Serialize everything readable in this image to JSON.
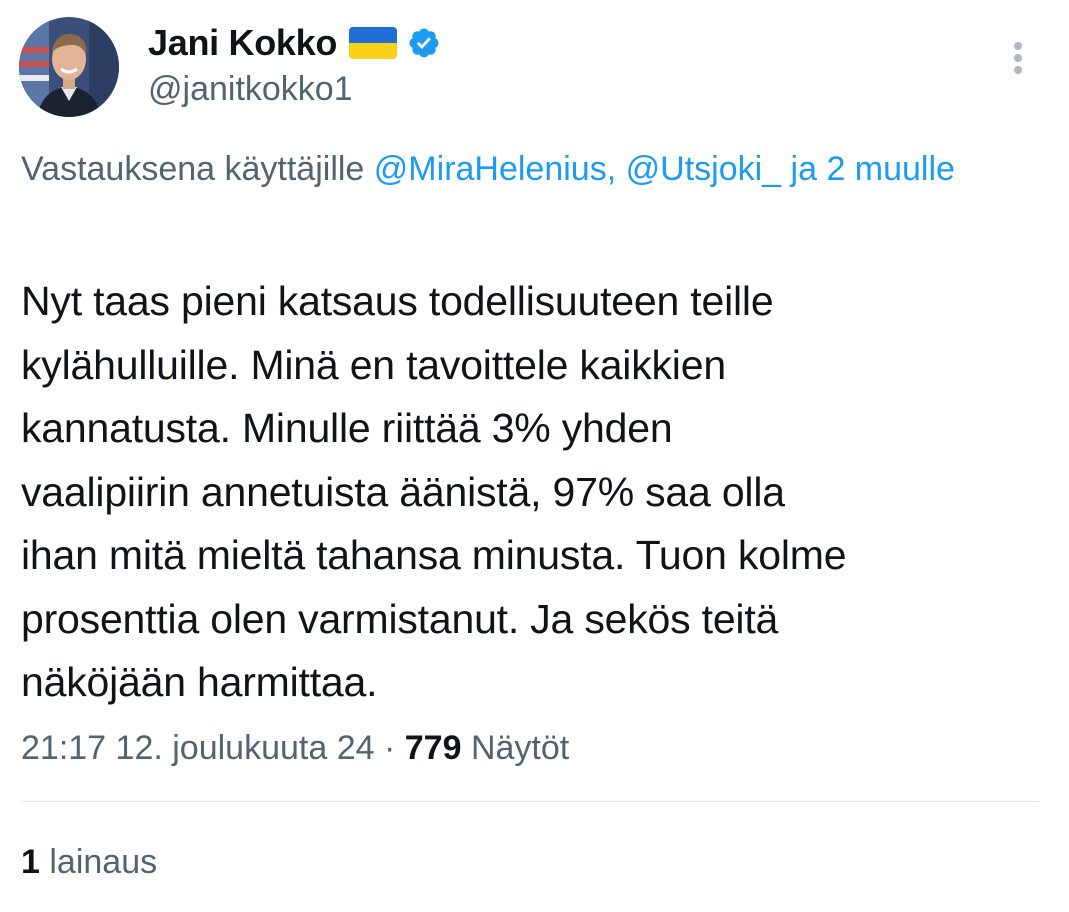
{
  "author": {
    "display_name": "Jani Kokko",
    "handle": "@janitkokko1",
    "flag_icon": "ukraine-flag-icon",
    "verified_icon": "verified-badge-icon",
    "avatar": "profile-photo"
  },
  "more_icon": "more-options-icon",
  "reply_context": {
    "prefix": "Vastauksena käyttäjille",
    "mentions": [
      "@MiraHelenius,",
      "@Utsjoki_"
    ],
    "suffix": "ja 2 muulle"
  },
  "tweet_text": "Nyt taas pieni katsaus todellisuuteen teille\nkylähulluille. Minä en tavoittele kaikkien\nkannatusta. Minulle riittää 3% yhden\nvaalipiirin annetuista äänistä, 97% saa olla\nihan mitä mieltä tahansa minusta. Tuon kolme\nprosenttia olen varmistanut. Ja sekös teitä\nnäköjään harmittaa.",
  "meta": {
    "time": "21:17",
    "date": "12. joulukuuta 24",
    "separator": "·",
    "views_count": "779",
    "views_label": "Näytöt"
  },
  "quotes": {
    "count": "1",
    "label": "lainaus"
  },
  "colors": {
    "text": "#0f1419",
    "secondary": "#536471",
    "link": "#1d9bf0",
    "divider": "#e1e8ed"
  }
}
